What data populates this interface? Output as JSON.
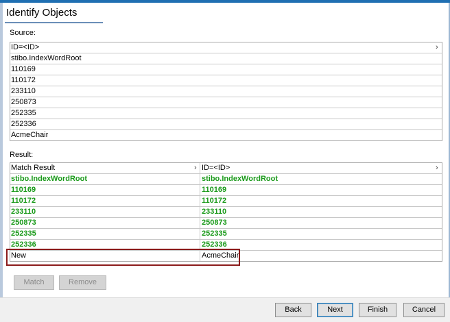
{
  "title": "Identify Objects",
  "source": {
    "label": "Source:",
    "header": "ID=<ID>",
    "rows": [
      "stibo.IndexWordRoot",
      "110169",
      "110172",
      "233110",
      "250873",
      "252335",
      "252336",
      "AcmeChair"
    ]
  },
  "result": {
    "label": "Result:",
    "col1_header": "Match Result",
    "col2_header": "ID=<ID>",
    "rows": [
      {
        "match": "stibo.IndexWordRoot",
        "id": "stibo.IndexWordRoot"
      },
      {
        "match": "110169",
        "id": "110169"
      },
      {
        "match": "110172",
        "id": "110172"
      },
      {
        "match": "233110",
        "id": "233110"
      },
      {
        "match": "250873",
        "id": "250873"
      },
      {
        "match": "252335",
        "id": "252335"
      },
      {
        "match": "252336",
        "id": "252336"
      },
      {
        "match": "New",
        "id": "AcmeChair"
      }
    ]
  },
  "buttons": {
    "match": "Match",
    "remove": "Remove",
    "back": "Back",
    "next": "Next",
    "finish": "Finish",
    "cancel": "Cancel"
  },
  "icons": {
    "chevron": "chevron-right-icon"
  },
  "colors": {
    "matched_text": "#1a9a1a",
    "highlight_border": "#8b1a1a",
    "title_bar": "#1f6fb2"
  }
}
